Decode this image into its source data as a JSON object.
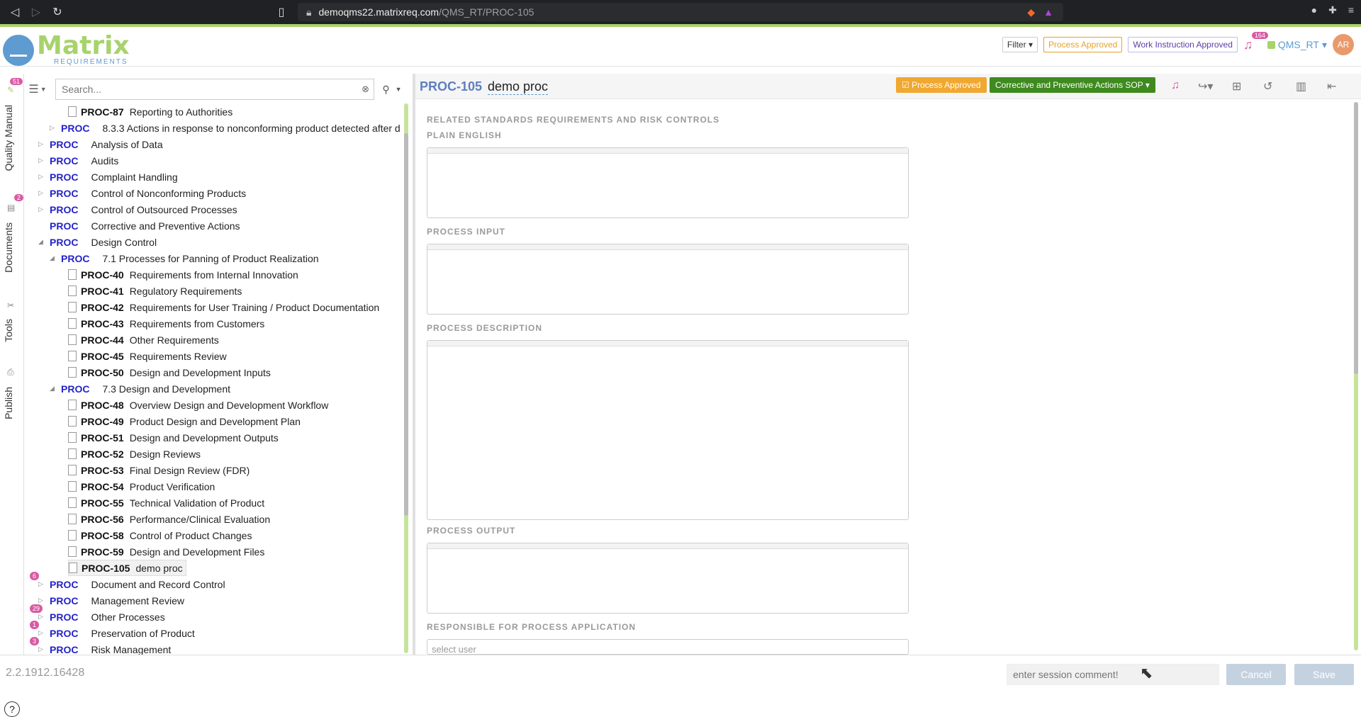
{
  "browser": {
    "url_host": "demoqms22.matrixreq.com",
    "url_path": "/QMS_RT/PROC-105"
  },
  "header": {
    "logo_word": "Matrix",
    "logo_sub": "REQUIREMENTS",
    "filter_label": "Filter",
    "process_approved_label": "Process Approved",
    "work_instruction_label": "Work Instruction Approved",
    "notification_count": "164",
    "project_name": "QMS_RT",
    "avatar_initials": "AR"
  },
  "vtabs": {
    "quality_manual": "Quality Manual",
    "quality_manual_badge": "51",
    "documents": "Documents",
    "documents_badge": "2",
    "tools": "Tools",
    "publish": "Publish",
    "help": "?"
  },
  "tree": {
    "search_placeholder": "Search...",
    "rows": [
      {
        "kind": "doc",
        "id": "PROC-87",
        "label": "Reporting to Authorities"
      },
      {
        "kind": "folder",
        "id": "PROC",
        "label": "8.3.3 Actions in response to nonconforming product detected after d",
        "toggle": "▷"
      },
      {
        "kind": "folder",
        "id": "PROC",
        "label": "Analysis of Data",
        "toggle": "▷"
      },
      {
        "kind": "folder",
        "id": "PROC",
        "label": "Audits",
        "toggle": "▷"
      },
      {
        "kind": "folder",
        "id": "PROC",
        "label": "Complaint Handling",
        "toggle": "▷"
      },
      {
        "kind": "folder",
        "id": "PROC",
        "label": "Control of Nonconforming Products",
        "toggle": "▷"
      },
      {
        "kind": "folder",
        "id": "PROC",
        "label": "Control of Outsourced Processes",
        "toggle": "▷"
      },
      {
        "kind": "folder",
        "id": "PROC",
        "label": "Corrective and Preventive Actions",
        "toggle": ""
      },
      {
        "kind": "folder",
        "id": "PROC",
        "label": "Design Control",
        "toggle": "◢"
      },
      {
        "kind": "folder",
        "id": "PROC",
        "label": "7.1 Processes for Panning of Product Realization",
        "toggle": "◢"
      },
      {
        "kind": "doc",
        "id": "PROC-40",
        "label": "Requirements from Internal Innovation"
      },
      {
        "kind": "doc",
        "id": "PROC-41",
        "label": "Regulatory Requirements"
      },
      {
        "kind": "doc",
        "id": "PROC-42",
        "label": "Requirements for User Training / Product Documentation"
      },
      {
        "kind": "doc",
        "id": "PROC-43",
        "label": "Requirements from Customers"
      },
      {
        "kind": "doc",
        "id": "PROC-44",
        "label": "Other Requirements"
      },
      {
        "kind": "doc",
        "id": "PROC-45",
        "label": "Requirements Review"
      },
      {
        "kind": "doc",
        "id": "PROC-50",
        "label": "Design and Development Inputs"
      },
      {
        "kind": "folder",
        "id": "PROC",
        "label": "7.3 Design and Development",
        "toggle": "◢"
      },
      {
        "kind": "doc",
        "id": "PROC-48",
        "label": "Overview Design and Development Workflow"
      },
      {
        "kind": "doc",
        "id": "PROC-49",
        "label": "Product Design and Development Plan"
      },
      {
        "kind": "doc",
        "id": "PROC-51",
        "label": "Design and Development Outputs"
      },
      {
        "kind": "doc",
        "id": "PROC-52",
        "label": "Design Reviews"
      },
      {
        "kind": "doc",
        "id": "PROC-53",
        "label": "Final Design Review (FDR)"
      },
      {
        "kind": "doc",
        "id": "PROC-54",
        "label": "Product Verification"
      },
      {
        "kind": "doc",
        "id": "PROC-55",
        "label": "Technical Validation of Product"
      },
      {
        "kind": "doc",
        "id": "PROC-56",
        "label": "Performance/Clinical Evaluation"
      },
      {
        "kind": "doc",
        "id": "PROC-58",
        "label": "Control of Product Changes"
      },
      {
        "kind": "doc",
        "id": "PROC-59",
        "label": "Design and Development Files"
      },
      {
        "kind": "doc",
        "id": "PROC-105",
        "label": "demo proc",
        "selected": true
      },
      {
        "kind": "folder",
        "id": "PROC",
        "label": "Document and Record Control",
        "toggle": "▷",
        "badge": "6"
      },
      {
        "kind": "folder",
        "id": "PROC",
        "label": "Management Review",
        "toggle": "▷"
      },
      {
        "kind": "folder",
        "id": "PROC",
        "label": "Other Processes",
        "toggle": "▷",
        "badge": "29"
      },
      {
        "kind": "folder",
        "id": "PROC",
        "label": "Preservation of Product",
        "toggle": "▷",
        "badge": "1"
      },
      {
        "kind": "folder",
        "id": "PROC",
        "label": "Risk Management",
        "toggle": "▷",
        "badge": "3"
      }
    ]
  },
  "item": {
    "id": "PROC-105",
    "title": "demo proc",
    "label_pa": "Process Approved",
    "label_capa": "Corrective and Preventive Actions SOP",
    "sections": {
      "related": "RELATED STANDARDS REQUIREMENTS AND RISK CONTROLS",
      "plain_english": "PLAIN ENGLISH",
      "process_input": "PROCESS INPUT",
      "process_description": "PROCESS DESCRIPTION",
      "process_output": "PROCESS OUTPUT",
      "responsible": "RESPONSIBLE FOR PROCESS APPLICATION"
    },
    "user_select_placeholder": "select user"
  },
  "footer": {
    "version": "2.2.1912.16428",
    "session_placeholder": "enter session comment!",
    "cancel_label": "Cancel",
    "save_label": "Save"
  }
}
